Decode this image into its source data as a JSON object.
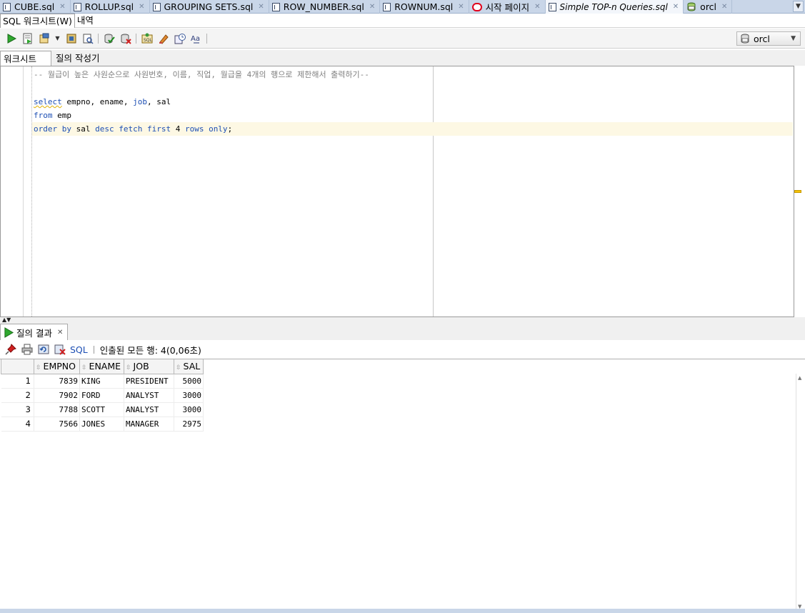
{
  "tabs": [
    {
      "label": "CUBE.sql",
      "icon": "sql-file-icon"
    },
    {
      "label": "ROLLUP.sql",
      "icon": "sql-file-icon"
    },
    {
      "label": "GROUPING SETS.sql",
      "icon": "sql-file-icon"
    },
    {
      "label": "ROW_NUMBER.sql",
      "icon": "sql-file-icon"
    },
    {
      "label": "ROWNUM.sql",
      "icon": "sql-file-icon"
    },
    {
      "label": "시작 페이지",
      "icon": "oracle-start-icon"
    },
    {
      "label": "Simple TOP-n Queries.sql",
      "icon": "sql-file-icon",
      "active": true
    },
    {
      "label": "orcl",
      "icon": "database-connection-icon"
    }
  ],
  "subtabs": {
    "worksheet": "SQL 워크시트(W)",
    "history": "내역"
  },
  "connection": {
    "selected": "orcl"
  },
  "worksheet_tabs": {
    "worksheet": "워크시트",
    "query_builder": "질의 작성기"
  },
  "editor": {
    "comment": "-- 월급이 높은 사원순으로 사원번호, 이름, 직업, 월급을 4개의 행으로 제한해서 출력하기--",
    "line1": {
      "kw": "select",
      "rest1": " empno, ename, ",
      "kw2": "job",
      "rest2": ", sal"
    },
    "line2": {
      "kw": "from",
      "rest": " emp"
    },
    "line3": {
      "kw1": "order by",
      "t1": " sal ",
      "kw2": "desc fetch first",
      "t2": " 4 ",
      "kw3": "rows only",
      "t3": ";"
    }
  },
  "results": {
    "tab_label": "질의 결과",
    "sql_label": "SQL",
    "status": "인출된 모든 행: 4(0,06초)",
    "columns": [
      "EMPNO",
      "ENAME",
      "JOB",
      "SAL"
    ],
    "rows": [
      {
        "n": "1",
        "empno": "7839",
        "ename": "KING",
        "job": "PRESIDENT",
        "sal": "5000"
      },
      {
        "n": "2",
        "empno": "7902",
        "ename": "FORD",
        "job": "ANALYST",
        "sal": "3000"
      },
      {
        "n": "3",
        "empno": "7788",
        "ename": "SCOTT",
        "job": "ANALYST",
        "sal": "3000"
      },
      {
        "n": "4",
        "empno": "7566",
        "ename": "JONES",
        "job": "MANAGER",
        "sal": "2975"
      }
    ]
  },
  "colors": {
    "tab_strip": "#c9d6e8",
    "keyword": "#1d4fb4",
    "comment": "#808080",
    "current_line": "#fdf8e4"
  }
}
